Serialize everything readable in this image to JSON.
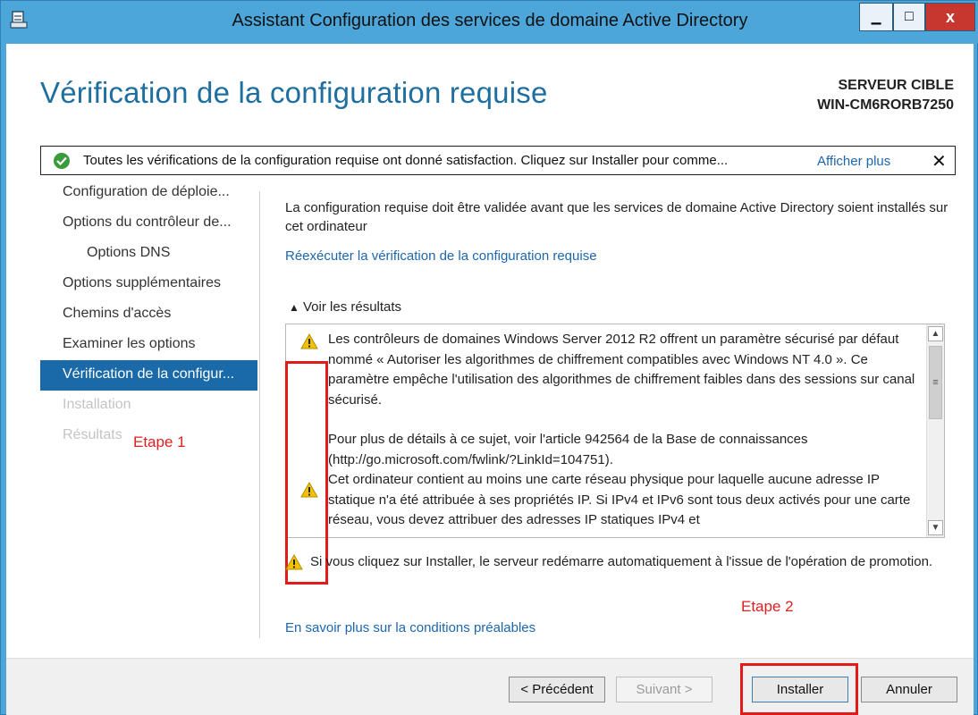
{
  "window": {
    "title": "Assistant Configuration des services de domaine Active Directory",
    "minimize_glyph": "▁",
    "maximize_glyph": "□",
    "close_glyph": "x"
  },
  "page": {
    "title": "Vérification de la configuration requise",
    "target_label": "SERVEUR CIBLE",
    "target_server": "WIN-CM6RORB7250"
  },
  "notification": {
    "text": "Toutes les vérifications de la configuration requise ont donné satisfaction. Cliquez sur Installer pour comme...",
    "link": "Afficher plus",
    "close": "✕",
    "icon": "check-circle-icon"
  },
  "sidebar": {
    "items": [
      {
        "label": "Configuration de déploie...",
        "state": "normal"
      },
      {
        "label": "Options du contrôleur de...",
        "state": "normal"
      },
      {
        "label": "Options DNS",
        "state": "sub"
      },
      {
        "label": "Options supplémentaires",
        "state": "normal"
      },
      {
        "label": "Chemins d'accès",
        "state": "normal"
      },
      {
        "label": "Examiner les options",
        "state": "normal"
      },
      {
        "label": "Vérification de la configur...",
        "state": "active"
      },
      {
        "label": "Installation",
        "state": "disabled"
      },
      {
        "label": "Résultats",
        "state": "disabled"
      }
    ]
  },
  "annotations": {
    "step1": "Etape 1",
    "step2": "Etape 2"
  },
  "main": {
    "intro": "La configuration requise doit être validée avant que les services de domaine Active Directory soient installés sur cet ordinateur",
    "rerun_link": "Réexécuter la vérification de la configuration requise",
    "results_toggle": "Voir les résultats",
    "results": [
      "Les contrôleurs de domaines Windows Server 2012 R2 offrent un paramètre sécurisé par défaut nommé « Autoriser les algorithmes de chiffrement compatibles avec Windows NT 4.0 ». Ce paramètre empêche l'utilisation des algorithmes de chiffrement faibles dans des sessions sur canal sécurisé.",
      "Pour plus de détails à ce sujet, voir l'article 942564 de la Base de connaissances (http://go.microsoft.com/fwlink/?LinkId=104751).",
      "Cet ordinateur contient au moins une carte réseau physique pour laquelle aucune adresse IP statique n'a été attribuée à ses propriétés IP. Si IPv4 et IPv6 sont tous deux activés pour une carte réseau, vous devez attribuer des adresses IP statiques IPv4 et"
    ],
    "restart_warning": "Si vous cliquez sur Installer, le serveur redémarre automatiquement à l'issue de l'opération de promotion.",
    "learn_link": "En savoir plus sur la conditions préalables"
  },
  "footer": {
    "previous": "< Précédent",
    "next": "Suivant >",
    "install": "Installer",
    "cancel": "Annuler"
  },
  "colors": {
    "accent": "#1a6aaa",
    "title": "#1e6f9f",
    "link": "#1c66b0",
    "annotation": "#e21a1a",
    "warning": "#f2c200",
    "success": "#3a9b3a"
  }
}
